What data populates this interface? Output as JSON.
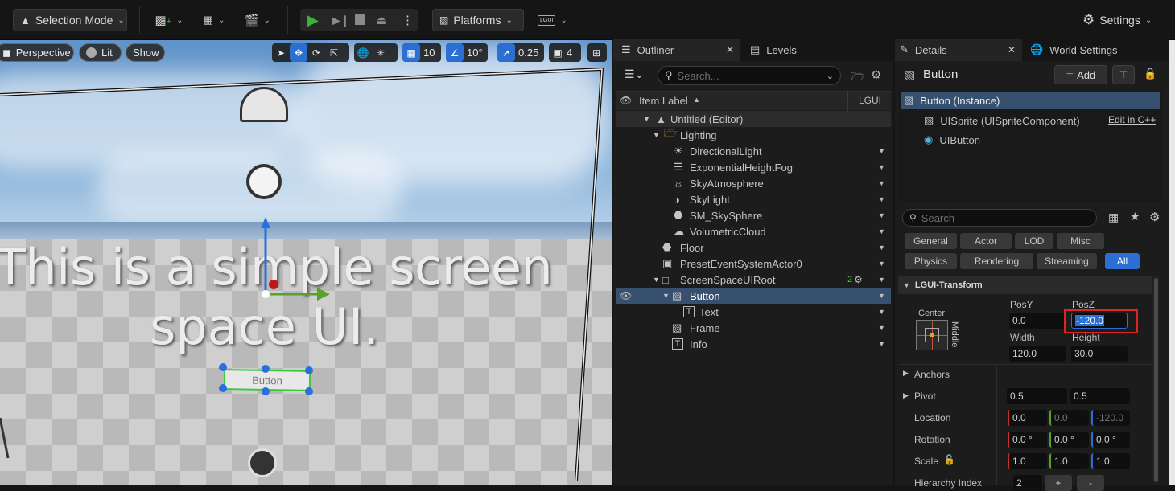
{
  "toolbar": {
    "selection_mode": "Selection Mode",
    "platforms": "Platforms",
    "settings": "Settings",
    "lgui_badge": "LGUI"
  },
  "viewport": {
    "perspective": "Perspective",
    "lit": "Lit",
    "show": "Show",
    "grid_snap": "10",
    "rotation_snap": "10°",
    "scale_snap": "0.25",
    "camera_speed": "4",
    "text_line1": "This is a simple screen",
    "text_line2": "space UI.",
    "button_text": "Button"
  },
  "outliner": {
    "tab_label": "Outliner",
    "levels_tab": "Levels",
    "search_placeholder": "Search...",
    "col_item_label": "Item Label",
    "col_lgui": "LGUI",
    "items": [
      {
        "label": "Untitled (Editor)",
        "icon": "level-icon"
      },
      {
        "label": "Lighting",
        "icon": "folder-icon"
      },
      {
        "label": "DirectionalLight",
        "icon": "sun-icon"
      },
      {
        "label": "ExponentialHeightFog",
        "icon": "fog-icon"
      },
      {
        "label": "SkyAtmosphere",
        "icon": "atmosphere-icon"
      },
      {
        "label": "SkyLight",
        "icon": "skylight-icon"
      },
      {
        "label": "SM_SkySphere",
        "icon": "cube-icon"
      },
      {
        "label": "VolumetricCloud",
        "icon": "cloud-icon"
      },
      {
        "label": "Floor",
        "icon": "cube-icon"
      },
      {
        "label": "PresetEventSystemActor0",
        "icon": "actor-icon"
      },
      {
        "label": "ScreenSpaceUIRoot",
        "icon": "ui-root-icon"
      },
      {
        "label": "Button",
        "icon": "image-icon"
      },
      {
        "label": "Text",
        "icon": "text-icon"
      },
      {
        "label": "Frame",
        "icon": "image-icon"
      },
      {
        "label": "Info",
        "icon": "text-icon"
      }
    ],
    "root_badge": "2"
  },
  "details": {
    "tab_label": "Details",
    "world_settings_tab": "World Settings",
    "object_name": "Button",
    "add_label": "Add",
    "instance_label": "Button (Instance)",
    "component1": "UISprite (UISpriteComponent)",
    "edit_cpp": "Edit in C++",
    "component2": "UIButton",
    "search_placeholder": "Search",
    "filters_row1": [
      "General",
      "Actor",
      "LOD",
      "Misc"
    ],
    "filters_row2": [
      "Physics",
      "Rendering",
      "Streaming",
      "All"
    ],
    "section": "LGUI-Transform",
    "anchor_h": "Center",
    "anchor_v": "Middle",
    "posy_label": "PosY",
    "posz_label": "PosZ",
    "posy": "0.0",
    "posz": "-120.0",
    "width_label": "Width",
    "height_label": "Height",
    "width": "120.0",
    "height": "30.0",
    "anchors_label": "Anchors",
    "pivot_label": "Pivot",
    "pivot_x": "0.5",
    "pivot_y": "0.5",
    "location_label": "Location",
    "location": [
      "0.0",
      "0.0",
      "-120.0"
    ],
    "rotation_label": "Rotation",
    "rotation": [
      "0.0 °",
      "0.0 °",
      "0.0 °"
    ],
    "scale_label": "Scale",
    "scale": [
      "1.0",
      "1.0",
      "1.0"
    ],
    "hierarchy_label": "Hierarchy Index",
    "hierarchy_value": "2",
    "plus": "+",
    "minus": "-"
  },
  "colors": {
    "accent": "#2a6fd1",
    "selection_row": "#38506f",
    "highlight_box": "#e02424",
    "play_green": "#3bb33b"
  }
}
